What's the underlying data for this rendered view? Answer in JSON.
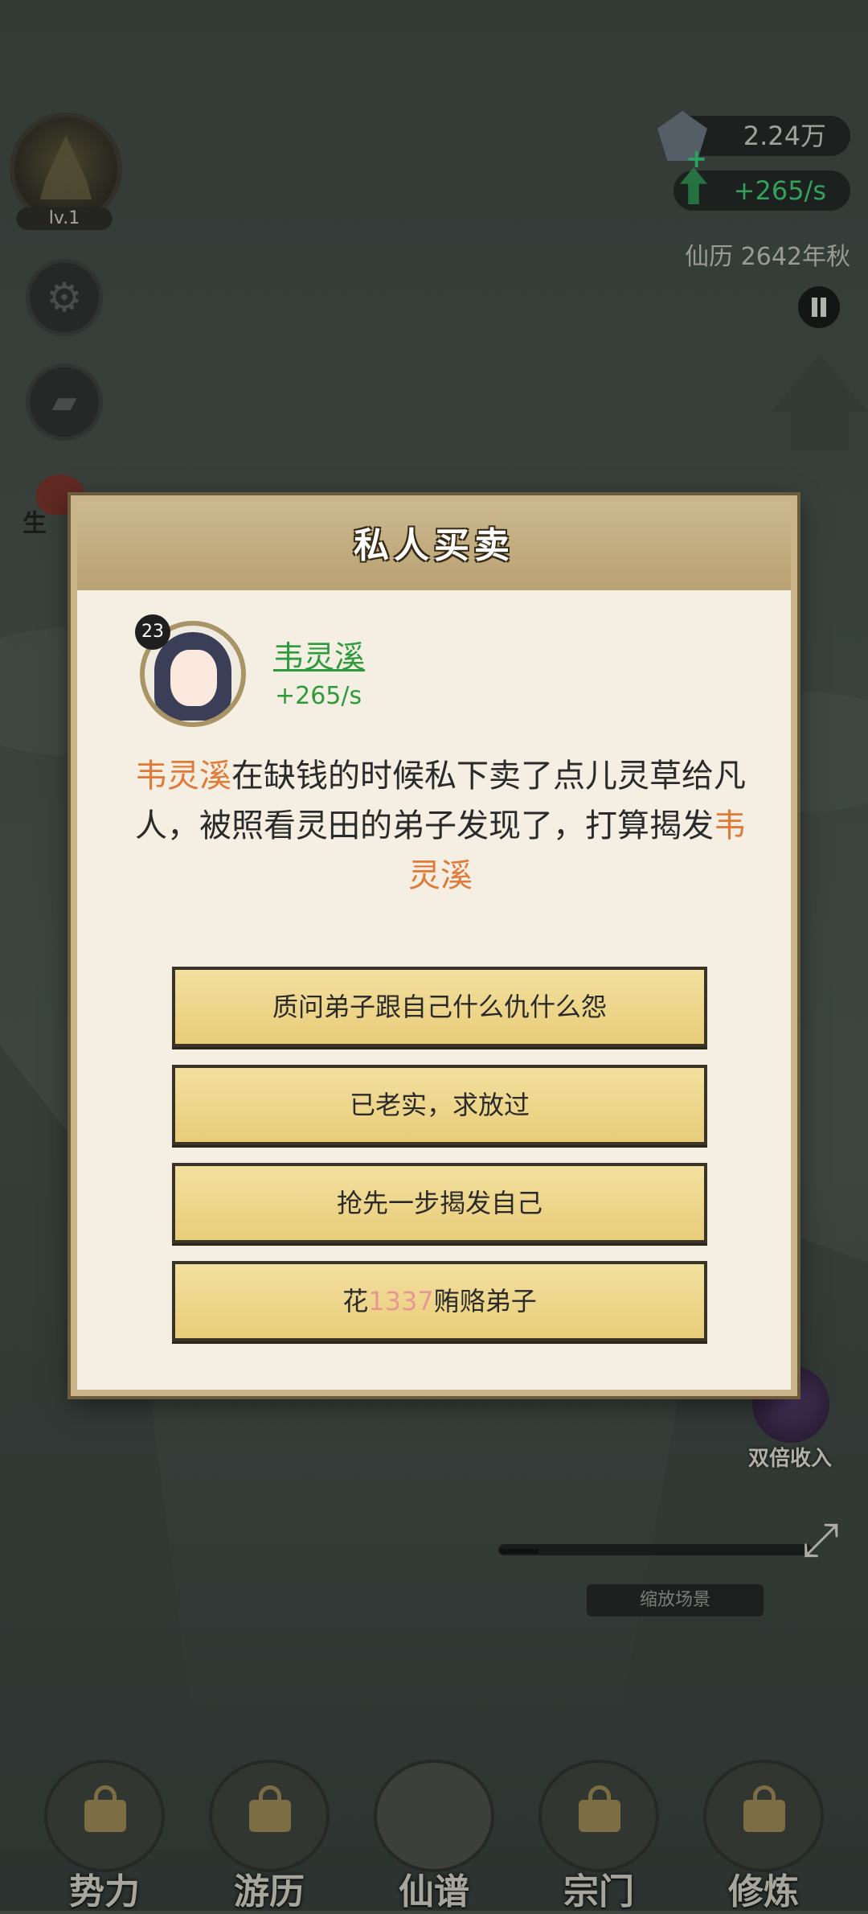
{
  "hud": {
    "level": "lv.1",
    "spirit_stones": "2.24万",
    "income_rate": "+265/s",
    "calendar": "仙历  2642年秋",
    "side_tab_label": "生"
  },
  "dialog": {
    "title": "私人买卖",
    "character": {
      "age": "23",
      "name": "韦灵溪",
      "rate": "+265/s"
    },
    "story": {
      "name_start": "韦灵溪",
      "text": "在缺钱的时候私下卖了点儿灵草给凡人，被照看灵田的弟子发现了，打算揭发",
      "name_end": "韦灵溪"
    },
    "options": [
      {
        "label": "质问弟子跟自己什么仇什么怨"
      },
      {
        "label": "已老实，求放过"
      },
      {
        "label": "抢先一步揭发自己"
      },
      {
        "prefix": "花",
        "amount": "1337",
        "suffix": "贿赂弟子"
      }
    ]
  },
  "controls": {
    "double_income": "双倍收入",
    "zoom_label": "缩放场景"
  },
  "bottom_nav": [
    {
      "label": "势力"
    },
    {
      "label": "游历"
    },
    {
      "label": "仙谱"
    },
    {
      "label": "宗门"
    },
    {
      "label": "修炼"
    }
  ],
  "colors": {
    "highlight_name": "#e07a38",
    "character_green": "#2d9a3c",
    "option_gold": "#e8cc78",
    "bribe_amount": "#e89894"
  }
}
